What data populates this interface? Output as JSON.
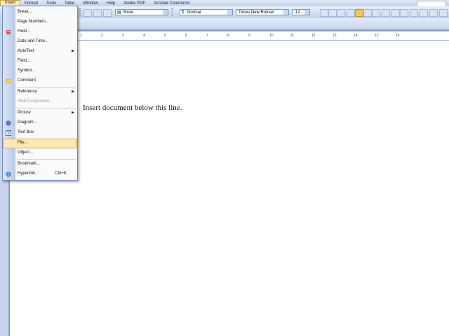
{
  "menubar": {
    "items": [
      "Insert",
      "Format",
      "Tools",
      "Table",
      "Window",
      "Help",
      "Adobe PDF",
      "Acrobat Comments"
    ],
    "active_index": 0
  },
  "toolbar": {
    "show_label": "Show",
    "style_value": "Normal",
    "font_value": "Times New Roman",
    "size_value": "12"
  },
  "ruler": {
    "ticks": [
      "1",
      "2",
      "3",
      "4",
      "5",
      "6",
      "7",
      "8",
      "9",
      "10",
      "11",
      "12",
      "13",
      "14",
      "15",
      "16"
    ]
  },
  "document": {
    "text": "Insert document below this line."
  },
  "insert_menu": {
    "items": [
      {
        "label": "Break...",
        "icon": "none"
      },
      {
        "label": "Page Numbers...",
        "icon": "none"
      },
      {
        "label": "Field...",
        "icon": "field-icon"
      },
      {
        "label": "Date and Time...",
        "icon": "none"
      },
      {
        "label": "AutoText",
        "icon": "none",
        "submenu": true
      },
      {
        "label": "Field...",
        "icon": "none"
      },
      {
        "label": "Symbol...",
        "icon": "none"
      },
      {
        "label": "Comment",
        "icon": "comment-icon"
      },
      {
        "label": "Reference",
        "icon": "none",
        "submenu": true
      },
      {
        "label": "Web Component...",
        "icon": "none",
        "disabled": true
      },
      {
        "label": "Picture",
        "icon": "none",
        "submenu": true
      },
      {
        "label": "Diagram...",
        "icon": "diagram-icon"
      },
      {
        "label": "Text Box",
        "icon": "textbox-icon"
      },
      {
        "label": "File...",
        "icon": "none",
        "highlighted": true
      },
      {
        "label": "Object...",
        "icon": "none"
      },
      {
        "label": "Bookmark...",
        "icon": "none"
      },
      {
        "label": "Hyperlink...",
        "icon": "hyperlink-icon",
        "shortcut": "Ctrl+K"
      }
    ],
    "submenu_arrow": "▶"
  },
  "colors": {
    "menu_highlight": "#fce8b2",
    "chrome": "#c6d5ee",
    "accent": "#f6c464"
  }
}
